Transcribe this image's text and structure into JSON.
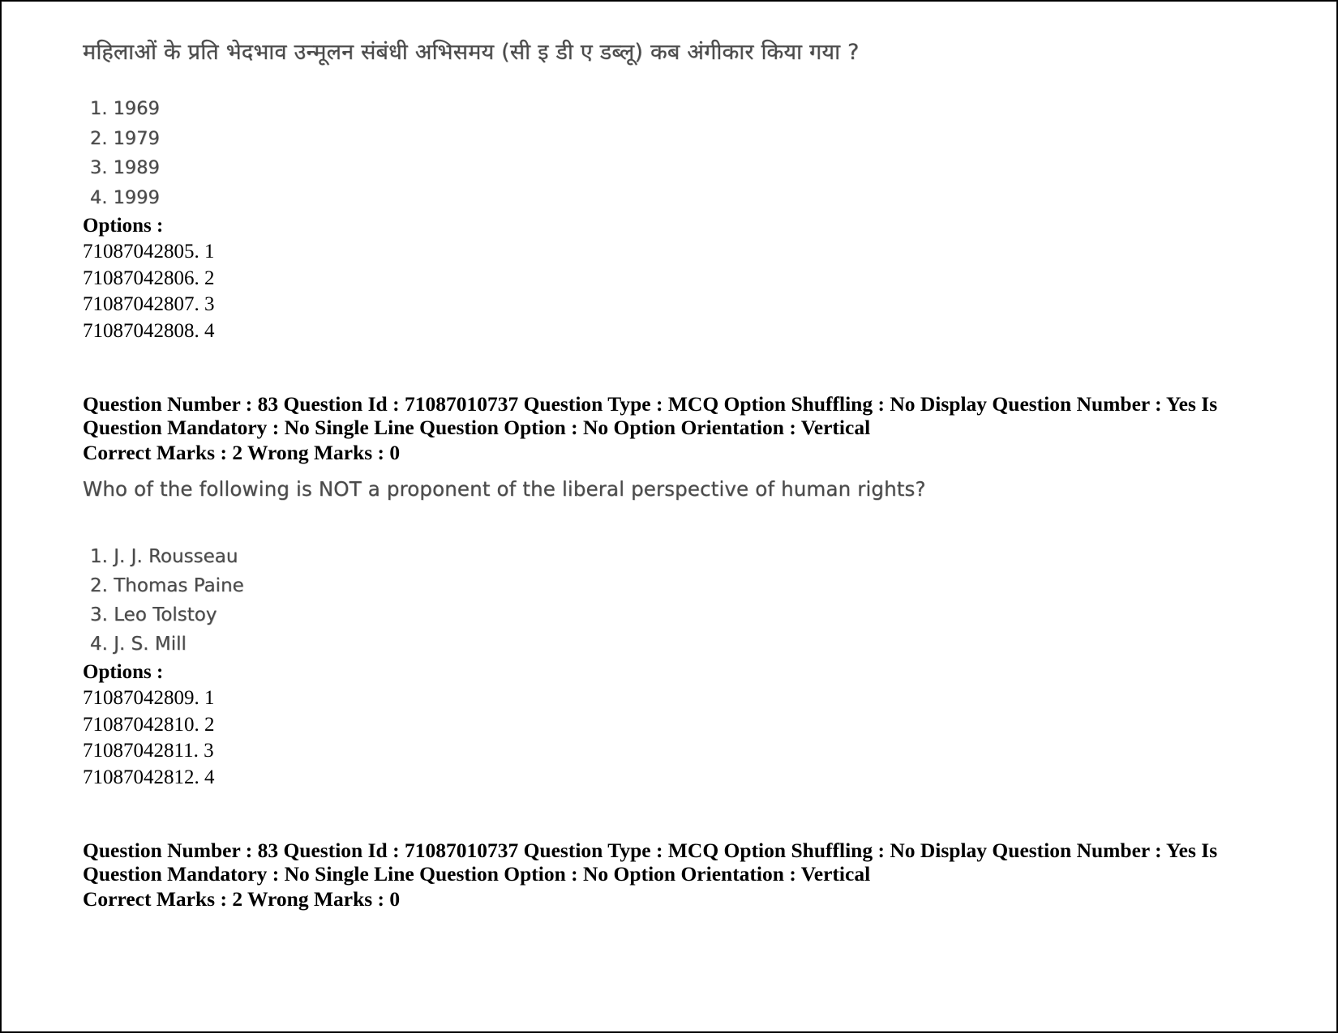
{
  "document": {
    "type": "exam-question-paper"
  },
  "question_1": {
    "text_hindi": "महिलाओं के प्रति भेदभाव उन्मूलन संबंधी अभिसमय (सी इ डी ए डब्लू) कब अंगीकार किया गया ?",
    "choices": [
      "1. 1969",
      "2. 1979",
      "3. 1989",
      "4. 1999"
    ],
    "options_label": "Options :",
    "option_ids": [
      "71087042805. 1",
      "71087042806. 2",
      "71087042807. 3",
      "71087042808. 4"
    ]
  },
  "meta_1": {
    "line1": "Question Number : 83 Question Id : 71087010737 Question Type : MCQ Option Shuffling : No Display Question Number : Yes Is",
    "line2": "Question Mandatory : No Single Line Question Option : No Option Orientation : Vertical",
    "marks": "Correct Marks : 2 Wrong Marks : 0"
  },
  "question_2": {
    "text_english": "Who of the following is NOT a proponent of the liberal perspective of human rights?",
    "choices": [
      "1. J. J. Rousseau",
      "2. Thomas Paine",
      "3. Leo Tolstoy",
      "4. J. S. Mill"
    ],
    "options_label": "Options :",
    "option_ids": [
      "71087042809. 1",
      "71087042810. 2",
      "71087042811. 3",
      "71087042812. 4"
    ]
  },
  "meta_2": {
    "line1": "Question Number : 83 Question Id : 71087010737 Question Type : MCQ Option Shuffling : No Display Question Number : Yes Is",
    "line2": "Question Mandatory : No Single Line Question Option : No Option Orientation : Vertical",
    "marks": "Correct Marks : 2 Wrong Marks : 0"
  }
}
